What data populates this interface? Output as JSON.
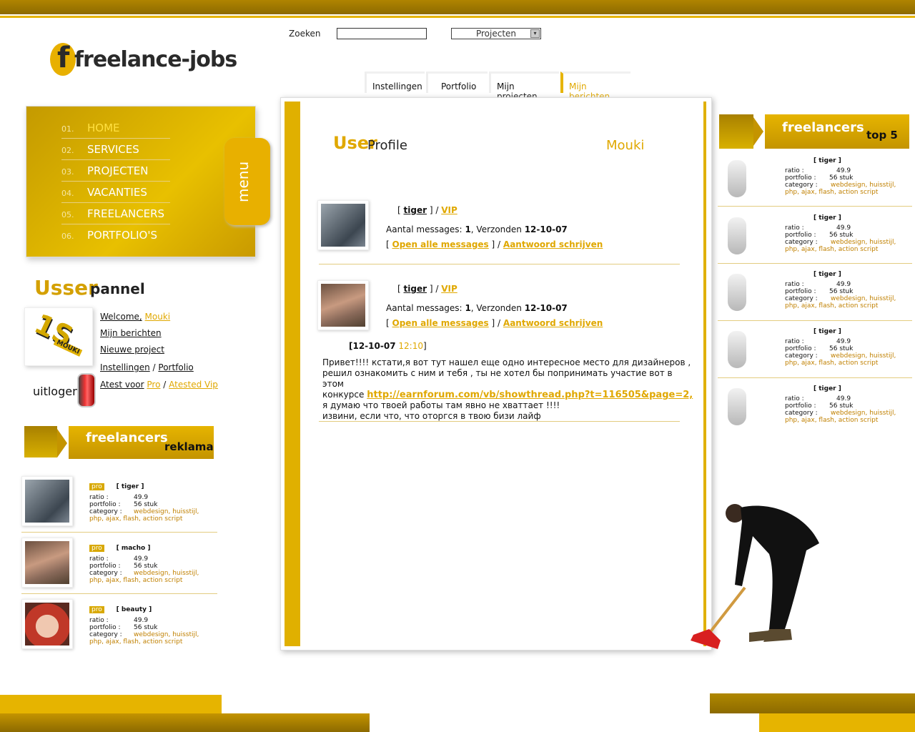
{
  "header": {
    "search_label": "Zoeken",
    "search_value": "",
    "category_select": "Projecten",
    "logo_text": "freelance-jobs",
    "tabs": [
      "Instellingen",
      "Portfolio",
      "Mijn projecten",
      "Mijn berichten"
    ]
  },
  "menu": {
    "tab_label": "menu",
    "items": [
      {
        "num": "01.",
        "label": "HOME"
      },
      {
        "num": "02.",
        "label": "SERVICES"
      },
      {
        "num": "03.",
        "label": "PROJECTEN"
      },
      {
        "num": "04.",
        "label": "VACANTIES"
      },
      {
        "num": "05.",
        "label": "FREELANCERS"
      },
      {
        "num": "06.",
        "label": "PORTFOLIO'S"
      }
    ]
  },
  "user_panel": {
    "title_a": "Usser",
    "title_b": "pannel",
    "avatar_text": "MOUKI",
    "welcome": "Welcome,",
    "username": "Mouki",
    "links": [
      "Mijn berichten",
      "Nieuwe project",
      "Instellingen",
      "Portfolio"
    ],
    "attest_prefix": "Atest voor",
    "attest_pro": "Pro",
    "attest_vip": "Atested Vip",
    "logout": "uitlogen",
    "separator": "/"
  },
  "reklama": {
    "title": "freelancers",
    "subtitle": "reklama",
    "entries": [
      {
        "badge": "pro",
        "name": "[ tiger ]",
        "ratio": "49.9",
        "portfolio": "56 stuk",
        "category": "webdesign, huisstijl,",
        "category2": "php, ajax, flash, action script"
      },
      {
        "badge": "pro",
        "name": "[ macho ]",
        "ratio": "49.9",
        "portfolio": "56 stuk",
        "category": "webdesign, huisstijl,",
        "category2": "php, ajax, flash, action script"
      },
      {
        "badge": "pro",
        "name": "[ beauty ]",
        "ratio": "49.9",
        "portfolio": "56 stuk",
        "category": "webdesign, huisstijl,",
        "category2": "php, ajax, flash, action script"
      }
    ],
    "labels": {
      "ratio": "ratio :",
      "portfolio": "portfolio :",
      "category": "category :"
    }
  },
  "main": {
    "title_a": "User",
    "title_b": "Profile",
    "username": "Mouki",
    "messages": [
      {
        "open": "[",
        "name": "tiger",
        "close": "] /",
        "vip": "VIP",
        "count_label": "Aantal messages:",
        "count": "1",
        "sent_label": ", Verzonden",
        "sent_date": "12-10-07",
        "b1": "[",
        "open_all": "Open alle messages",
        "b2": "] /",
        "reply": "Aantwoord schrijven"
      },
      {
        "open": "[",
        "name": "tiger",
        "close": "] /",
        "vip": "VIP",
        "count_label": "Aantal messages:",
        "count": "1",
        "sent_label": ", Verzonden",
        "sent_date": "12-10-07",
        "b1": "[",
        "open_all": "Open alle messages",
        "b2": "] /",
        "reply": "Aantwoord schrijven"
      }
    ],
    "msg_date": "[12-10-07",
    "msg_time": "12:10",
    "msg_close": "]",
    "body1": "Привет!!!! кстати,я вот тут нашел еще одно интересное место для дизайнеров ,",
    "body2": "решил ознакомить с ним и тебя , ты не хотел бы попринимать участие вот в этом",
    "body3_prefix": "конкурсе",
    "body3_link": "http://earnforum.com/vb/showthread.php?t=116505&page=2,",
    "body4": "я думаю что твоей работы там явно не хваттает !!!!",
    "body5": "извини, если что, что оторгся в твою бизи лайф"
  },
  "top5": {
    "title": "freelancers",
    "subtitle": "top 5",
    "labels": {
      "ratio": "ratio :",
      "portfolio": "portfolio :",
      "category": "category :"
    },
    "entries": [
      {
        "name": "[ tiger ]",
        "ratio": "49.9",
        "portfolio": "56 stuk",
        "category": "webdesign, huisstijl,",
        "category2": "php, ajax, flash, action script"
      },
      {
        "name": "[ tiger ]",
        "ratio": "49.9",
        "portfolio": "56 stuk",
        "category": "webdesign, huisstijl,",
        "category2": "php, ajax, flash, action script"
      },
      {
        "name": "[ tiger ]",
        "ratio": "49.9",
        "portfolio": "56 stuk",
        "category": "webdesign, huisstijl,",
        "category2": "php, ajax, flash, action script"
      },
      {
        "name": "[ tiger ]",
        "ratio": "49.9",
        "portfolio": "56 stuk",
        "category": "webdesign, huisstijl,",
        "category2": "php, ajax, flash, action script"
      },
      {
        "name": "[ tiger ]",
        "ratio": "49.9",
        "portfolio": "56 stuk",
        "category": "webdesign, huisstijl,",
        "category2": "php, ajax, flash, action script"
      }
    ]
  },
  "colors": {
    "accent": "#e6b400",
    "dark_gold": "#8c6a00",
    "link_yellow": "#e0a800"
  }
}
